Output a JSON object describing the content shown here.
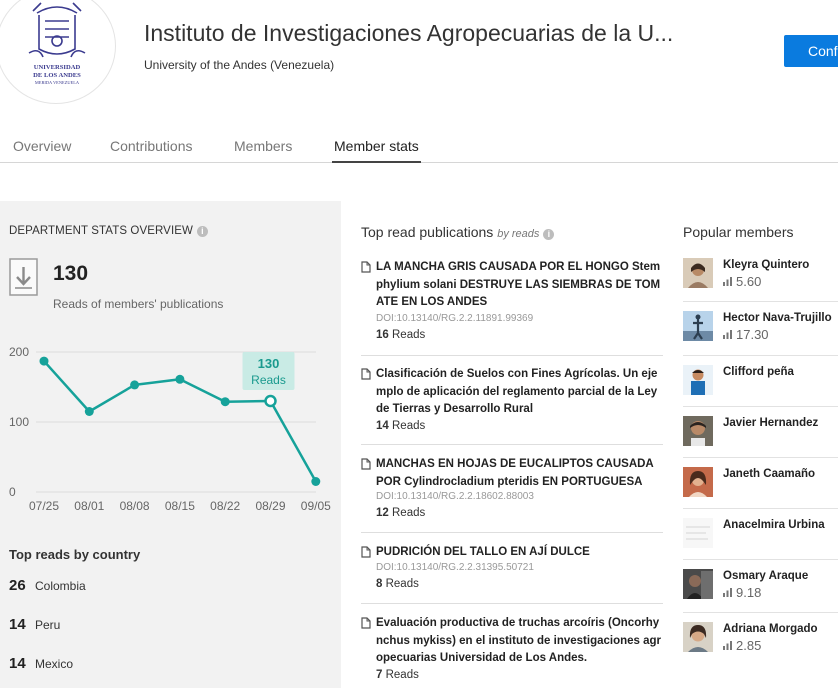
{
  "institution": {
    "title": "Instituto de Investigaciones Agropecuarias de la U...",
    "subtitle": "University of the Andes (Venezuela)",
    "confirm_label": "Conf",
    "logo_text": "UNIVERSIDAD DE LOS ANDES MERIDA VENEZUELA"
  },
  "tabs": [
    {
      "label": "Overview",
      "active": false
    },
    {
      "label": "Contributions",
      "active": false
    },
    {
      "label": "Members",
      "active": false
    },
    {
      "label": "Member stats",
      "active": true
    }
  ],
  "stats": {
    "title": "DEPARTMENT STATS OVERVIEW",
    "info_glyph": "i",
    "reads_total": "130",
    "reads_label": "Reads of members' publications"
  },
  "chart_data": {
    "type": "line",
    "categories": [
      "07/25",
      "08/01",
      "08/08",
      "08/15",
      "08/22",
      "08/29",
      "09/05"
    ],
    "series": [
      {
        "values": [
          187,
          115,
          153,
          161,
          129,
          130,
          15
        ]
      }
    ],
    "yticks": [
      "200",
      "100",
      "0"
    ],
    "ylim": [
      0,
      200
    ],
    "grid": true,
    "line_color": "#16a29a",
    "tooltip": {
      "index": 5,
      "value": "130",
      "label": "Reads"
    }
  },
  "countries": {
    "title": "Top reads by country",
    "items": [
      {
        "count": "26",
        "name": "Colombia"
      },
      {
        "count": "14",
        "name": "Peru"
      },
      {
        "count": "14",
        "name": "Mexico"
      }
    ]
  },
  "publications": {
    "title": "Top read publications",
    "subtitle": "by reads",
    "reads_word": "Reads",
    "items": [
      {
        "title": "LA MANCHA GRIS CAUSADA POR EL HONGO Stemphylium solani DESTRUYE LAS SIEMBRAS DE TOMATE EN LOS ANDES",
        "doi": "DOI:10.13140/RG.2.2.11891.99369",
        "reads": "16"
      },
      {
        "title": "Clasificación de Suelos con Fines Agrícolas. Un ejemplo de aplicación del reglamento parcial de la Ley de Tierras y Desarrollo Rural",
        "doi": "",
        "reads": "14"
      },
      {
        "title": "MANCHAS EN HOJAS DE EUCALIPTOS CAUSADA POR Cylindrocladium pteridis EN PORTUGUESA",
        "doi": "DOI:10.13140/RG.2.2.18602.88003",
        "reads": "12"
      },
      {
        "title": "PUDRICIÓN DEL TALLO EN AJÍ DULCE",
        "doi": "DOI:10.13140/RG.2.2.31395.50721",
        "reads": "8"
      },
      {
        "title": "Evaluación productiva de truchas arcoíris (Oncorhynchus mykiss) en el instituto de investigaciones agropecuarias Universidad de Los Andes.",
        "doi": "",
        "reads": "7"
      }
    ]
  },
  "members": {
    "title": "Popular members",
    "items": [
      {
        "name": "Kleyra Quintero",
        "score": "5.60"
      },
      {
        "name": "Hector Nava-Trujillo",
        "score": "17.30"
      },
      {
        "name": "Clifford peña",
        "score": ""
      },
      {
        "name": "Javier Hernandez",
        "score": ""
      },
      {
        "name": "Janeth Caamaño",
        "score": ""
      },
      {
        "name": "Anacelmira Urbina",
        "score": ""
      },
      {
        "name": "Osmary Araque",
        "score": "9.18"
      },
      {
        "name": "Adriana Morgado",
        "score": "2.85"
      }
    ]
  }
}
